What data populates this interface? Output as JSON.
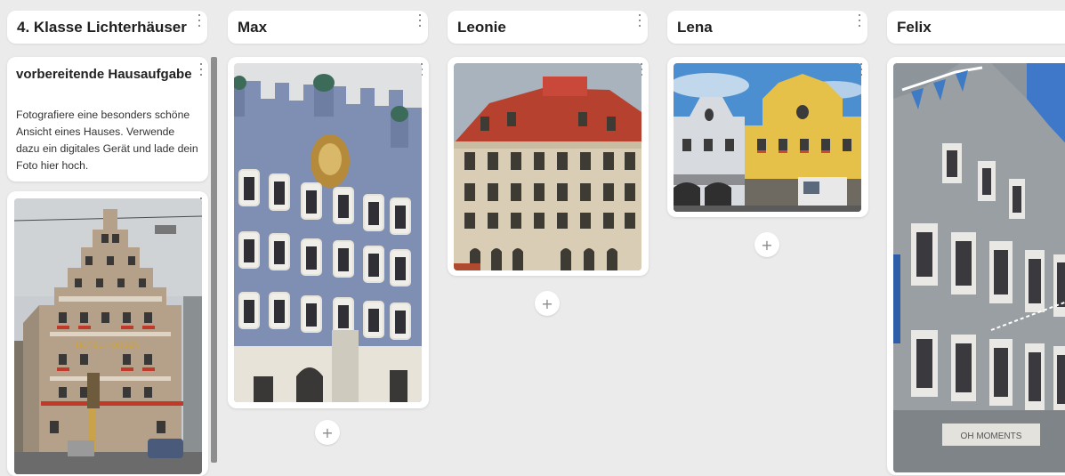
{
  "columns": [
    {
      "title": "4. Klasse Lichterhäuser"
    },
    {
      "title": "Max"
    },
    {
      "title": "Leonie"
    },
    {
      "title": "Lena"
    },
    {
      "title": "Felix"
    }
  ],
  "text_card": {
    "title": "vorbereitende Hausaufgabe",
    "body": "Fotografiere eine besonders schöne Ansicht eines Hauses. Verwende dazu ein digitales Gerät und lade dein Foto hier hoch."
  },
  "photo_signs": {
    "hotel": "HOTEL HOHSEN",
    "shop": "OH MOMENTS"
  },
  "add_label": "+",
  "colors": {
    "background": "#ebebeb",
    "card": "#ffffff",
    "scrollbar": "#8e8e8e"
  },
  "icons": [
    "more-options-icon",
    "plus-icon"
  ]
}
